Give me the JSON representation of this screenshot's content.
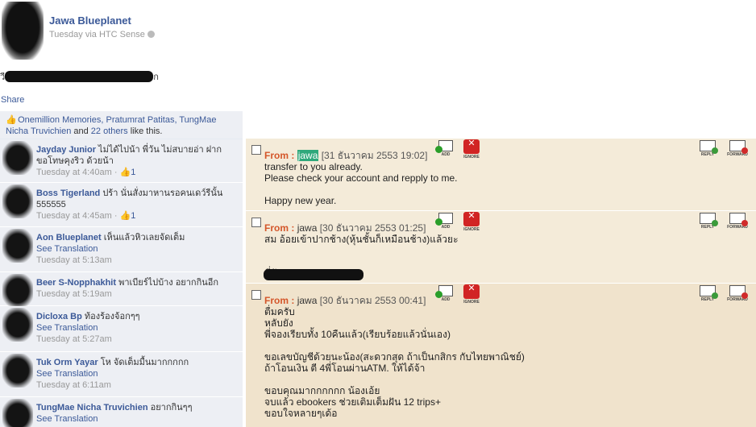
{
  "post": {
    "author": "Jawa Blueplanet",
    "meta": "Tuesday via HTC Sense",
    "text_prefix": "วี",
    "text_suffix": "ก",
    "share": "Share"
  },
  "likes": {
    "names": "Onemillion Memories, Pratumrat Patitas, TungMae Nicha Truvichien",
    "and": " and ",
    "others": "22 others",
    "suffix": " like this."
  },
  "comments": [
    {
      "name": "Jayday Junior",
      "text": "ไม่ได้ไปน้า พี่วัน ไม่สบายอ่า ฝากขอโทษคุงริว ด้วยน้า",
      "time": "Tuesday at 4:40am",
      "like": "1"
    },
    {
      "name": "Boss Tigerland",
      "text": "ปร้า นั่นสั่งมาหานรอคนเดว์รีนั้น 555555",
      "time": "Tuesday at 4:45am",
      "like": "1"
    },
    {
      "name": "Aon Blueplanet",
      "text": "เห็นแล้วหิวเลยจัดเต็ม",
      "translation": "See Translation",
      "time": "Tuesday at 5:13am"
    },
    {
      "name": "Beer S-Nopphakhit",
      "text": "พาเบียร์ไปบ้าง อยากกินอีก",
      "time": "Tuesday at 5:19am"
    },
    {
      "name": "Dicloxa Bp",
      "text": "ท้องร้องจ้อกๆๆ",
      "translation": "See Translation",
      "time": "Tuesday at 5:27am"
    },
    {
      "name": "Tuk Orm Yayar",
      "text": "โห จัดเต็มมื้นมากกกกก",
      "translation": "See Translation",
      "time": "Tuesday at 6:11am"
    },
    {
      "name": "TungMae Nicha Truvichien",
      "text": "อยากกินๆๆ",
      "translation": "See Translation"
    }
  ],
  "messages": [
    {
      "from_label": "From :",
      "sender": "jawa",
      "date": "[31 ธันวาคม 2553 19:02]",
      "body": "transfer to you already.\nPlease check your account and repply to me.\n\nHappy new year."
    },
    {
      "from_label": "From :",
      "sender": "jawa",
      "date": "[30 ธันวาคม 2553 01:25]",
      "body": "สม อ้อยเข้าปากช้าง(หุ้นชั้นก็เหมือนช้าง)แล้วยะ\n\n\nพี่วัน"
    },
    {
      "from_label": "From :",
      "sender": "jawa",
      "date": "[30 ธันวาคม 2553 00:41]",
      "body": "ตื่มครับ\nหลับยัง\nพี่จองเรียบทั้ง 10คืนแล้ว(เรียบร้อยแล้วนั่นเอง)\n\nขอเลขบัญชีด้วยนะน้อง(สะดวกสุด ถ้าเป็นกสิกร กับไทยพาณิชย์)\nถ้าโอนเงิน ตี 4พี่โอนผ่านATM. ให้ได้จ้า\n\nขอบคุณมากกกกกก น้องเอ้ย\nจบแล้ว ebookers ช่วยเติมเต็มฝัน 12 trips+\nขอบใจหลายๆเด้อ"
    }
  ],
  "buttons": {
    "add": "ADD",
    "ignore": "IGNORE",
    "reply": "REPLY",
    "forward": "FORWARD"
  }
}
